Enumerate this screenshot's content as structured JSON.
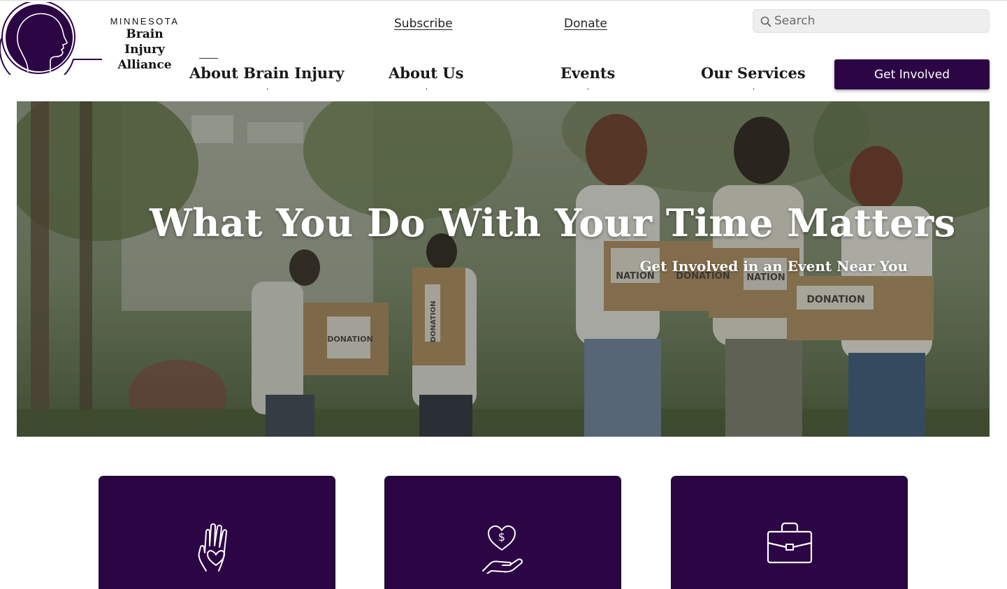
{
  "brand": {
    "state": "MINNESOTA",
    "name_line1": "Brain Injury",
    "name_line2": "Alliance",
    "color": "#2c0544"
  },
  "top_links": {
    "subscribe": "Subscribe",
    "donate": "Donate"
  },
  "search": {
    "placeholder": "Search",
    "icon": "search-icon"
  },
  "nav": {
    "items": [
      {
        "label": "About Brain Injury"
      },
      {
        "label": "About Us"
      },
      {
        "label": "Events"
      },
      {
        "label": "Our Services"
      }
    ],
    "cta_label": "Get Involved"
  },
  "hero": {
    "title": "What You Do With Your Time Matters",
    "subtitle": "Get Involved in an Event Near You",
    "image_box_labels": [
      "DONATION",
      "DONATION",
      "NATION",
      "DONATION",
      "NATION",
      "DONATION"
    ]
  },
  "cards": [
    {
      "icon": "hand-heart-icon"
    },
    {
      "icon": "donation-heart-hand-icon"
    },
    {
      "icon": "briefcase-icon"
    }
  ]
}
